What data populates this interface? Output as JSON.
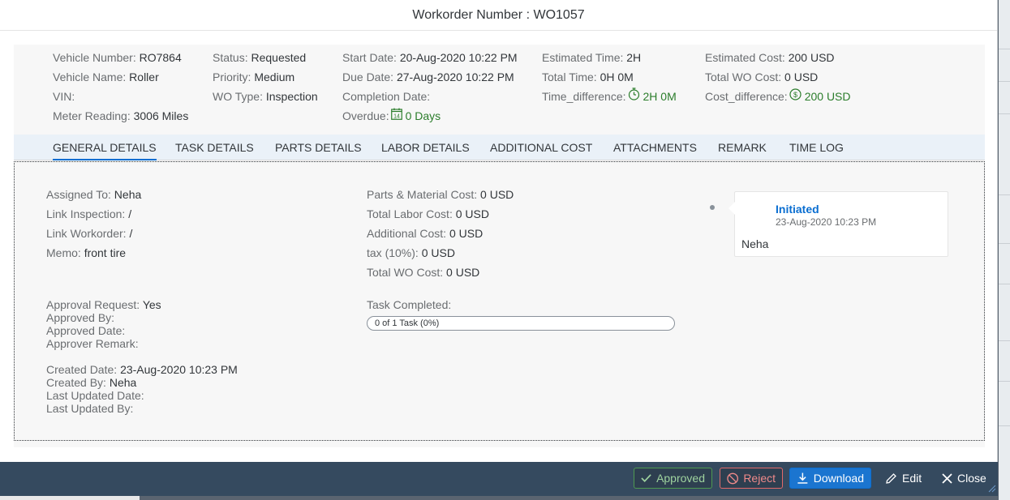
{
  "dialog": {
    "title": "Workorder Number : WO1057"
  },
  "header": {
    "col1": [
      {
        "label": "Vehicle Number:",
        "value": "RO7864"
      },
      {
        "label": "Vehicle Name:",
        "value": "Roller"
      },
      {
        "label": "VIN:",
        "value": ""
      },
      {
        "label": "Meter Reading:",
        "value": "3006 Miles"
      }
    ],
    "col2": [
      {
        "label": "Status:",
        "value": "Requested"
      },
      {
        "label": "Priority:",
        "value": "Medium"
      },
      {
        "label": "WO Type:",
        "value": "Inspection"
      }
    ],
    "col3": [
      {
        "label": "Start Date:",
        "value": "20-Aug-2020 10:22 PM"
      },
      {
        "label": "Due Date:",
        "value": "27-Aug-2020 10:22 PM"
      },
      {
        "label": "Completion Date:",
        "value": ""
      },
      {
        "label": "Overdue:",
        "value": "0 Days",
        "icon": "calendar-icon",
        "icon_text": "14"
      }
    ],
    "col4": [
      {
        "label": "Estimated Time:",
        "value": "2H"
      },
      {
        "label": "Total Time:",
        "value": "0H 0M"
      },
      {
        "label": "Time_difference:",
        "value": "2H 0M",
        "icon": "stopwatch-icon"
      }
    ],
    "col5": [
      {
        "label": "Estimated Cost:",
        "value": "200 USD"
      },
      {
        "label": "Total WO Cost:",
        "value": "0 USD"
      },
      {
        "label": "Cost_difference:",
        "value": "200 USD",
        "icon": "dollar-circle-icon",
        "icon_text": "$"
      }
    ]
  },
  "tabs": [
    {
      "label": "GENERAL DETAILS",
      "active": true
    },
    {
      "label": "TASK DETAILS"
    },
    {
      "label": "PARTS DETAILS"
    },
    {
      "label": "LABOR DETAILS"
    },
    {
      "label": "ADDITIONAL COST"
    },
    {
      "label": "ATTACHMENTS"
    },
    {
      "label": "REMARK"
    },
    {
      "label": "TIME LOG"
    }
  ],
  "general": {
    "assignment": [
      {
        "label": "Assigned To:",
        "value": "Neha"
      },
      {
        "label": "Link Inspection:",
        "value": " /"
      },
      {
        "label": "Link Workorder:",
        "value": " /"
      },
      {
        "label": "Memo:",
        "value": "front tire"
      }
    ],
    "approval": [
      {
        "label": "Approval Request:",
        "value": "Yes"
      },
      {
        "label": "Approved By:",
        "value": ""
      },
      {
        "label": "Approved Date:",
        "value": ""
      },
      {
        "label": "Approver Remark:",
        "value": ""
      }
    ],
    "audit": [
      {
        "label": "Created Date:",
        "value": "23-Aug-2020 10:23 PM"
      },
      {
        "label": "Created By:",
        "value": "Neha"
      },
      {
        "label": "Last Updated Date:",
        "value": ""
      },
      {
        "label": "Last Updated By:",
        "value": ""
      }
    ],
    "costs": [
      {
        "label": "Parts & Material Cost:",
        "value": "0 USD"
      },
      {
        "label": "Total Labor Cost:",
        "value": "0 USD"
      },
      {
        "label": "Additional Cost:",
        "value": "0 USD"
      },
      {
        "label": "tax (10%):",
        "value": "0 USD"
      },
      {
        "label": "Total WO Cost:",
        "value": "0 USD"
      }
    ],
    "task_completed_label": "Task Completed:",
    "task_progress_text": "0 of 1 Task (0%)",
    "task_progress_fraction": 0
  },
  "timeline": {
    "title": "Initiated",
    "date": "23-Aug-2020 10:23 PM",
    "user": "Neha"
  },
  "footer": {
    "approved": "Approved",
    "reject": "Reject",
    "download": "Download",
    "edit": "Edit",
    "close": "Close"
  },
  "colors": {
    "accent": "#0a6ed1",
    "success": "#2b7d2b",
    "footer_bg": "#354a5f",
    "reject": "#e26a6a"
  }
}
